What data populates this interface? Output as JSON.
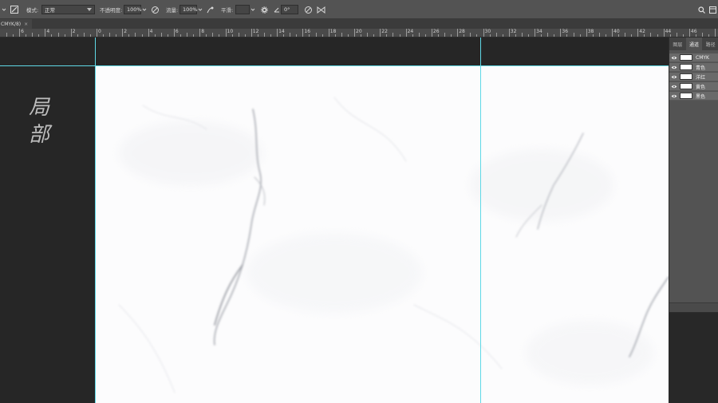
{
  "options_bar": {
    "mode_label": "模式:",
    "mode_value": "正常",
    "opacity_label": "不透明度:",
    "opacity_value": "100%",
    "flow_label": "流量:",
    "flow_value": "100%",
    "smoothing_label": "平滑:",
    "angle_value": "0°"
  },
  "document_tab": {
    "title": "CMYK/8)",
    "close": "×"
  },
  "ruler": {
    "labels": [
      "6",
      "4",
      "2",
      "0",
      "2",
      "4",
      "6",
      "8",
      "10",
      "12",
      "14",
      "16",
      "18",
      "20",
      "22",
      "24",
      "26",
      "28",
      "30",
      "32",
      "34",
      "36",
      "38",
      "40",
      "42",
      "44",
      "46"
    ]
  },
  "canvas_text": {
    "calligraphy": "局部"
  },
  "channels_panel": {
    "tabs": [
      "图层",
      "通道",
      "路径"
    ],
    "active_tab": "通道",
    "channels": [
      {
        "name": "CMYK"
      },
      {
        "name": "青色"
      },
      {
        "name": "洋红"
      },
      {
        "name": "黄色"
      },
      {
        "name": "黑色"
      }
    ]
  },
  "colors": {
    "guide": "#5fd8e6",
    "canvas": "#fcfcfd",
    "workspace": "#262626"
  }
}
